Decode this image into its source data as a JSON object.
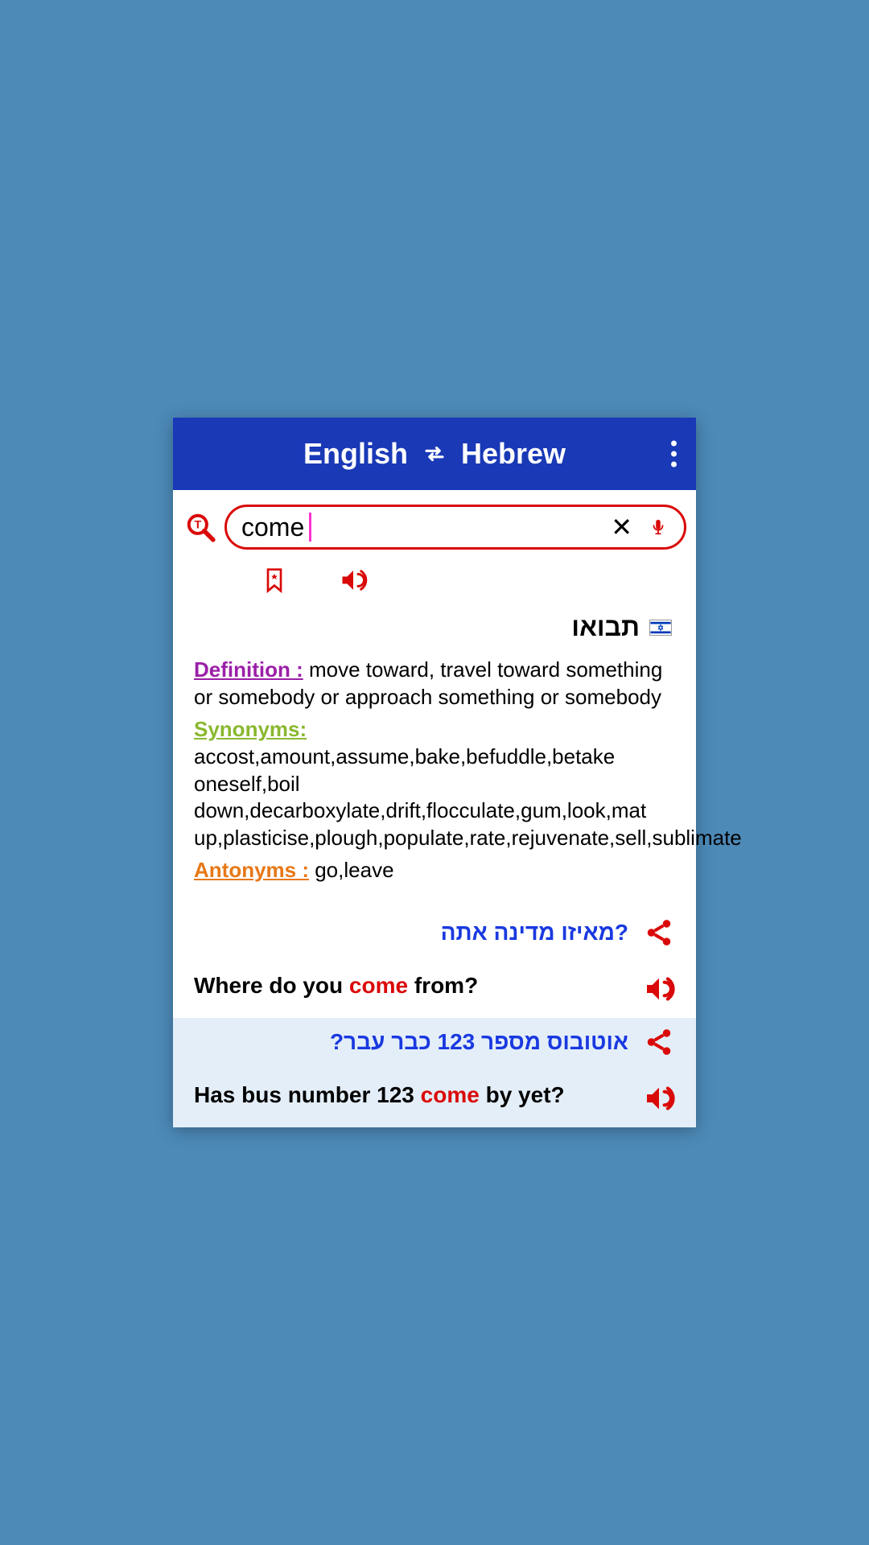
{
  "header": {
    "lang_from": "English",
    "lang_to": "Hebrew"
  },
  "search": {
    "value": "come"
  },
  "translation": {
    "hebrew": "תבואו"
  },
  "definition": {
    "label": "Definition :",
    "text": " move toward, travel toward something or somebody or approach something or somebody"
  },
  "synonyms": {
    "label": "Synonyms:",
    "text": " accost,amount,assume,bake,befuddle,betake oneself,boil down,decarboxylate,drift,flocculate,gum,look,mat up,plasticise,plough,populate,rate,rejuvenate,sell,sublimate"
  },
  "antonyms": {
    "label": "Antonyms :",
    "text": " go,leave"
  },
  "examples": [
    {
      "hebrew": "?מאיזו מדינה אתה",
      "english_pre": "Where do you ",
      "english_hl": "come",
      "english_post": " from?"
    },
    {
      "hebrew": "אוטובוס מספר 123 כבר עבר?",
      "english_pre": "Has bus number 123 ",
      "english_hl": "come",
      "english_post": " by yet?"
    }
  ]
}
